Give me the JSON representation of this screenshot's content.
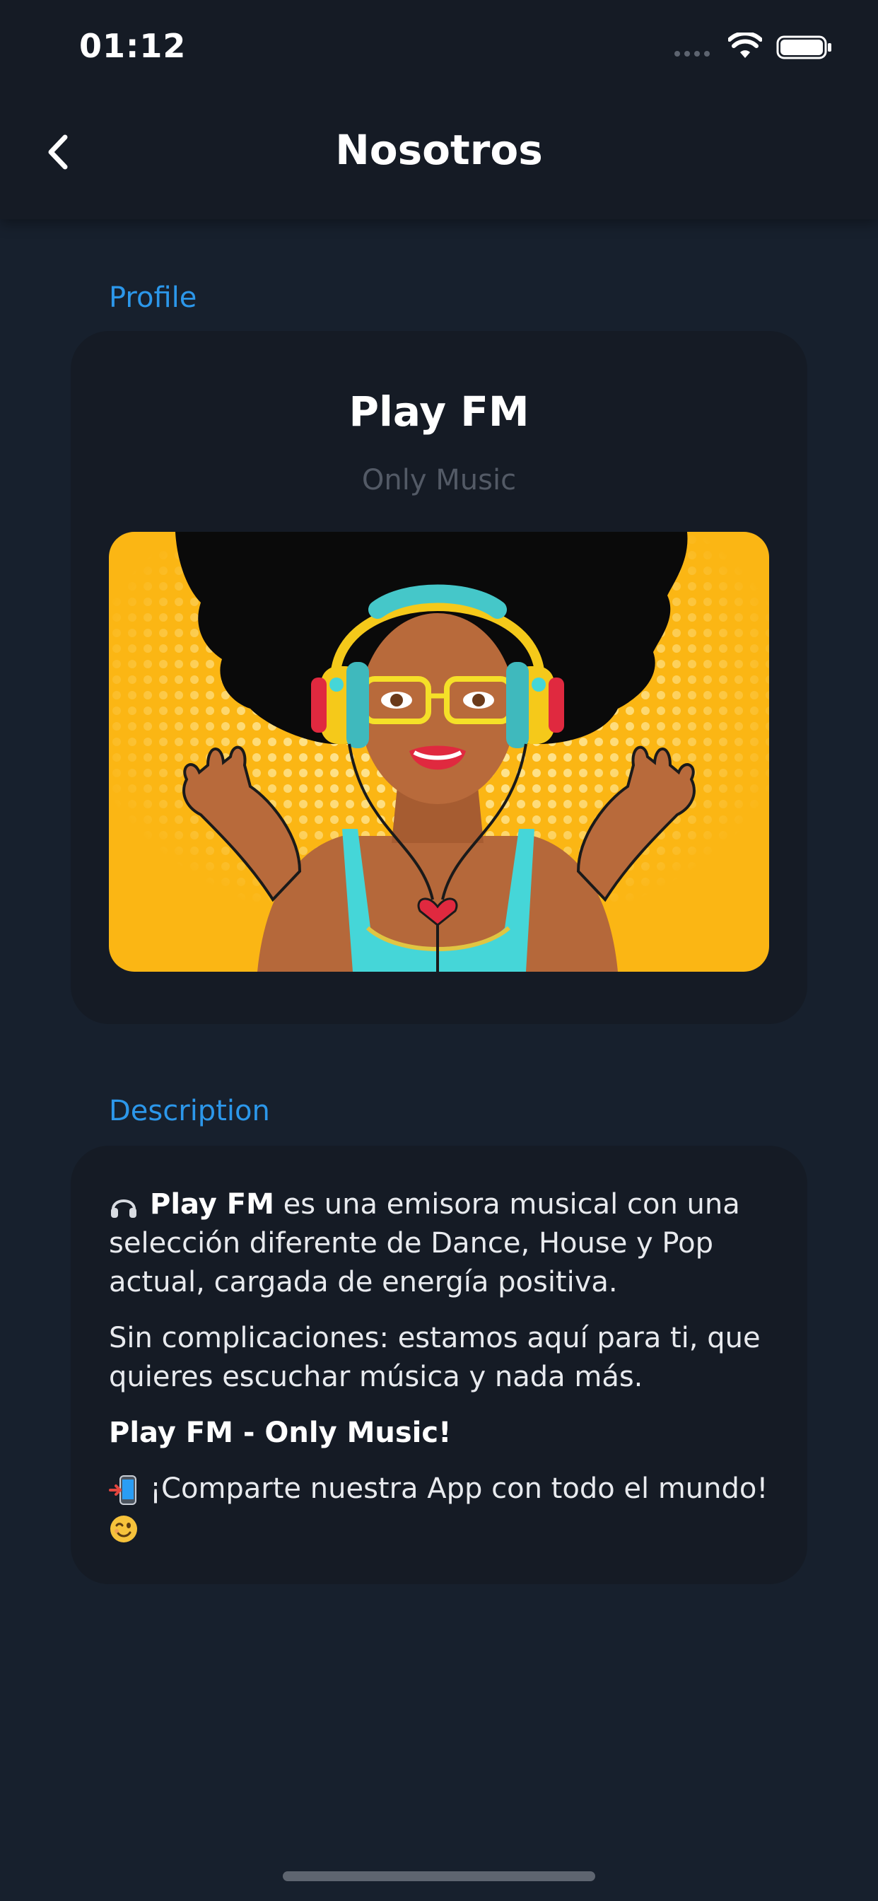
{
  "status_bar": {
    "time": "01:12"
  },
  "header": {
    "title": "Nosotros",
    "back_icon": "chevron-left-icon"
  },
  "profile": {
    "section_label": "Profile",
    "station_name": "Play FM",
    "tagline": "Only Music",
    "artwork_alt": "Pop-art woman with afro hair wearing yellow headphones"
  },
  "description": {
    "section_label": "Description",
    "p1_name": "Play FM",
    "p1_text": " es una emisora musical con una selección diferente de Dance, House y Pop actual, cargada de energía positiva.",
    "p2_text": "Sin complicaciones: estamos aquí para ti, que quieres escuchar música y nada más.",
    "p3_text": "Play FM - Only Music!",
    "p4_text": "¡Comparte nuestra App con todo el mundo!",
    "icons": [
      "headphones-icon",
      "phone-share-icon",
      "wink-emoji-icon"
    ]
  },
  "colors": {
    "background": "#17202d",
    "card": "#151b25",
    "accent": "#2c97ea",
    "muted": "#535a66",
    "artwork_yellow": "#fbb614"
  }
}
